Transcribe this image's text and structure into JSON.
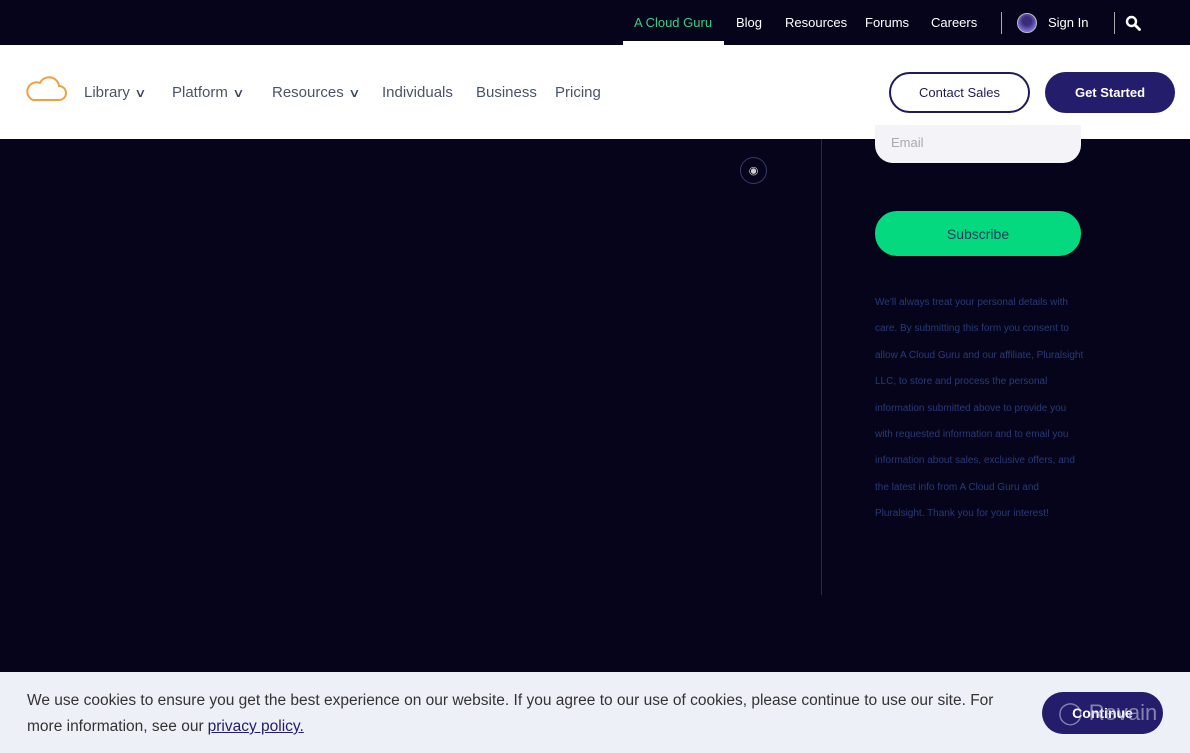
{
  "topbar": {
    "items": [
      {
        "label": "A Cloud Guru",
        "active": true
      },
      {
        "label": "Blog"
      },
      {
        "label": "Resources"
      },
      {
        "label": "Forums"
      },
      {
        "label": "Careers"
      }
    ],
    "sign_in": "Sign In",
    "search_icon": "search-icon",
    "active_color": "#2fd28a"
  },
  "nav": {
    "logo_icon": "cloud-icon",
    "items": [
      {
        "label": "Library",
        "dropdown": true
      },
      {
        "label": "Platform",
        "dropdown": true
      },
      {
        "label": "Resources",
        "dropdown": true
      },
      {
        "label": "Individuals"
      },
      {
        "label": "Business"
      },
      {
        "label": "Pricing"
      }
    ],
    "contact_sales": "Contact Sales",
    "get_started": "Get Started"
  },
  "footer": {
    "email_placeholder": "Email",
    "subscribe": "Subscribe",
    "rss_icon": "rss-icon",
    "legal": "We'll always treat your personal details with care. By submitting this form you consent to allow A Cloud Guru and our affiliate, Pluralsight LLC, to store and process the personal information submitted above to provide you with requested information and to email you information about sales, exclusive offers, and the latest info from A Cloud Guru and Pluralsight. Thank you for your interest!"
  },
  "cookie": {
    "text": "We use cookies to ensure you get the best experience on our website. If you agree to our use of cookies, please continue to use our site. For more information, see our",
    "link": "privacy policy.",
    "continue": "Continue"
  },
  "watermark": "Revain",
  "colors": {
    "background": "#05041a",
    "brand": "#231d6b",
    "accent": "#05d980"
  }
}
